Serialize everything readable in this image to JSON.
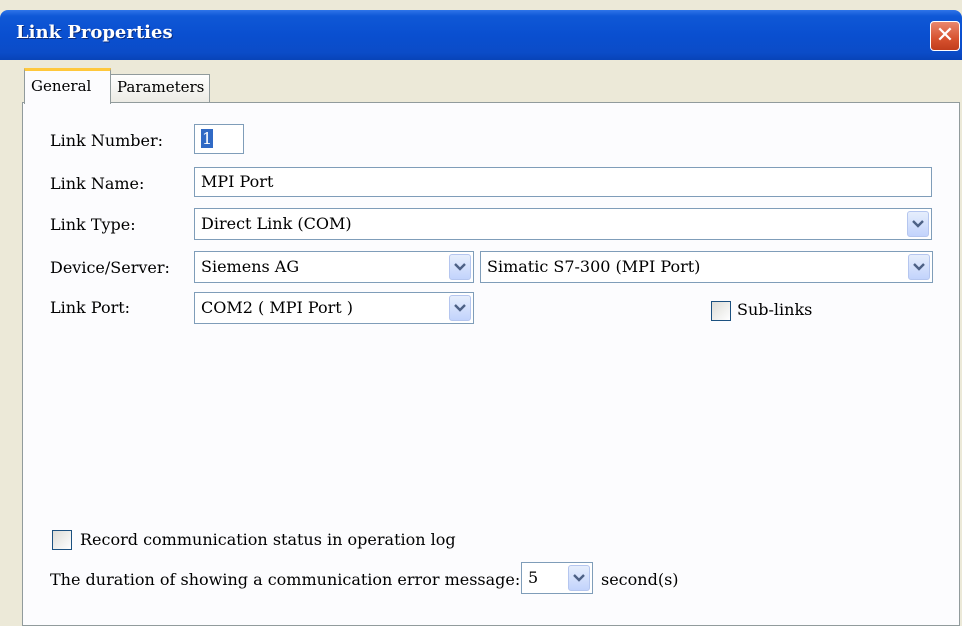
{
  "window": {
    "title": "Link Properties",
    "close_symbol": "✕"
  },
  "tabs": [
    {
      "label": "General",
      "active": true
    },
    {
      "label": "Parameters",
      "active": false
    }
  ],
  "form": {
    "link_number": {
      "label": "Link Number:",
      "value": "1"
    },
    "link_name": {
      "label": "Link Name:",
      "value": "MPI Port"
    },
    "link_type": {
      "label": "Link Type:",
      "value": "Direct Link (COM)"
    },
    "device_server": {
      "label": "Device/Server:",
      "vendor": "Siemens AG",
      "model": "Simatic S7-300 (MPI Port)"
    },
    "link_port": {
      "label": "Link Port:",
      "value": "COM2 ( MPI Port )"
    },
    "sub_links": {
      "label": "Sub-links",
      "checked": false
    }
  },
  "footer": {
    "record_status": {
      "label": "Record communication status in operation log",
      "checked": false
    },
    "error_duration": {
      "label": "The duration of showing a communication error message:",
      "value": "5",
      "unit": "second(s)"
    }
  },
  "colors": {
    "titlebar": "#0a4fd0",
    "tab_highlight": "#ffc83c",
    "input_border": "#7f9db9",
    "dialog_bg": "#ece9d8"
  },
  "icons": {
    "dropdown": "chevron-down-icon",
    "close": "close-icon"
  }
}
